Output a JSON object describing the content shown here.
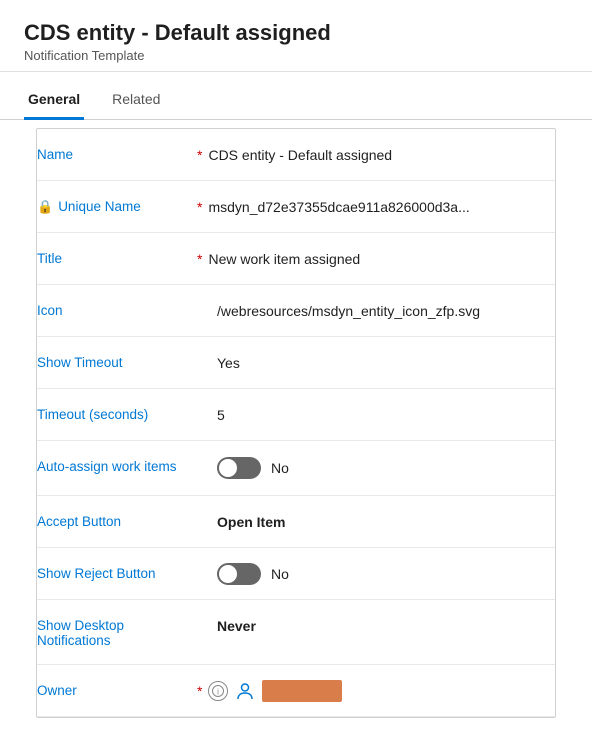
{
  "header": {
    "title": "CDS entity - Default assigned",
    "subtitle": "Notification Template"
  },
  "tabs": [
    {
      "id": "general",
      "label": "General",
      "active": true
    },
    {
      "id": "related",
      "label": "Related",
      "active": false
    }
  ],
  "fields": [
    {
      "id": "name",
      "label": "Name",
      "required": true,
      "value": "CDS entity - Default assigned",
      "type": "text",
      "bold": false,
      "locked": false
    },
    {
      "id": "unique-name",
      "label": "Unique Name",
      "required": true,
      "value": "msdyn_d72e37355dcae911a826000d3a...",
      "type": "text",
      "bold": false,
      "locked": true
    },
    {
      "id": "title",
      "label": "Title",
      "required": true,
      "value": "New work item assigned",
      "type": "text",
      "bold": false,
      "locked": false
    },
    {
      "id": "icon",
      "label": "Icon",
      "required": false,
      "value": "/webresources/msdyn_entity_icon_zfp.svg",
      "type": "text",
      "bold": false,
      "locked": false
    },
    {
      "id": "show-timeout",
      "label": "Show Timeout",
      "required": false,
      "value": "Yes",
      "type": "text",
      "bold": false,
      "locked": false
    },
    {
      "id": "timeout-seconds",
      "label": "Timeout (seconds)",
      "required": false,
      "value": "5",
      "type": "text",
      "bold": false,
      "locked": false
    },
    {
      "id": "auto-assign",
      "label": "Auto-assign work items",
      "required": false,
      "value": "No",
      "type": "toggle",
      "bold": false,
      "locked": false,
      "tall": true
    },
    {
      "id": "accept-button",
      "label": "Accept Button",
      "required": false,
      "value": "Open Item",
      "type": "text",
      "bold": true,
      "locked": false
    },
    {
      "id": "show-reject",
      "label": "Show Reject Button",
      "required": false,
      "value": "No",
      "type": "toggle",
      "bold": false,
      "locked": false
    },
    {
      "id": "show-desktop",
      "label": "Show Desktop Notifications",
      "required": false,
      "value": "Never",
      "type": "text",
      "bold": true,
      "locked": false,
      "tall": true
    },
    {
      "id": "owner",
      "label": "Owner",
      "required": true,
      "value": "",
      "type": "owner",
      "bold": false,
      "locked": false
    }
  ],
  "icons": {
    "lock": "🔒",
    "person": "👤",
    "info": "ℹ"
  }
}
